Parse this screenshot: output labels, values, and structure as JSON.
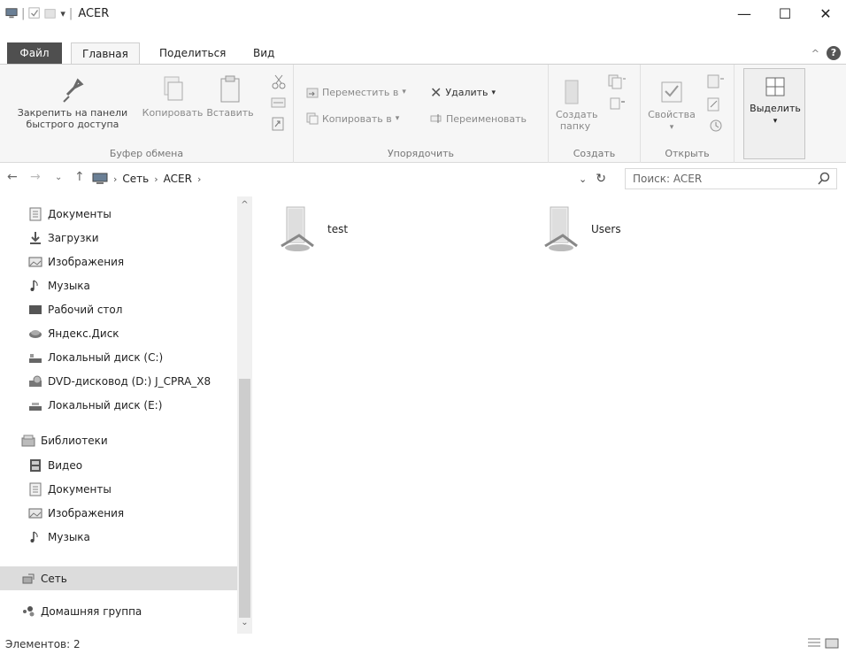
{
  "window": {
    "title": "ACER",
    "minimize": "—",
    "maximize": "☐",
    "close": "✕"
  },
  "ribbon_tabs": {
    "file": "Файл",
    "home": "Главная",
    "share": "Поделиться",
    "view": "Вид"
  },
  "ribbon": {
    "pin_line1": "Закрепить на панели",
    "pin_line2": "быстрого доступа",
    "copy": "Копировать",
    "paste": "Вставить",
    "clipboard_group": "Буфер обмена",
    "move_to": "Переместить в",
    "copy_to": "Копировать в",
    "delete": "Удалить",
    "rename": "Переименовать",
    "organize_group": "Упорядочить",
    "new_folder_line1": "Создать",
    "new_folder_line2": "папку",
    "new_group": "Создать",
    "properties": "Свойства",
    "open_group": "Открыть",
    "select": "Выделить"
  },
  "address": {
    "segments": [
      "Сеть",
      "ACER"
    ],
    "search_placeholder": "Поиск: ACER"
  },
  "nav_pane": {
    "items": [
      {
        "label": "Документы",
        "icon": "documents-icon"
      },
      {
        "label": "Загрузки",
        "icon": "downloads-icon"
      },
      {
        "label": "Изображения",
        "icon": "pictures-icon"
      },
      {
        "label": "Музыка",
        "icon": "music-icon"
      },
      {
        "label": "Рабочий стол",
        "icon": "desktop-icon"
      },
      {
        "label": "Яндекс.Диск",
        "icon": "yandex-disk-icon"
      },
      {
        "label": "Локальный диск (C:)",
        "icon": "drive-icon"
      },
      {
        "label": "DVD-дисковод (D:) J_CPRA_X8",
        "icon": "dvd-icon"
      },
      {
        "label": "Локальный диск (E:)",
        "icon": "drive-icon"
      },
      {
        "label": "Библиотеки",
        "icon": "libraries-icon"
      },
      {
        "label": "Видео",
        "icon": "video-icon"
      },
      {
        "label": "Документы",
        "icon": "documents-icon"
      },
      {
        "label": "Изображения",
        "icon": "pictures-icon"
      },
      {
        "label": "Музыка",
        "icon": "music-icon"
      },
      {
        "label": "Сеть",
        "icon": "network-icon"
      },
      {
        "label": "Домашняя группа",
        "icon": "homegroup-icon"
      }
    ]
  },
  "content": {
    "folders": [
      {
        "name": "test"
      },
      {
        "name": "Users"
      }
    ]
  },
  "status": {
    "items_count": "Элементов: 2"
  },
  "colors": {
    "file_tab": "#4f4f4f",
    "ribbon_bg": "#f6f6f6",
    "selected_nav": "#dcdcdc"
  }
}
